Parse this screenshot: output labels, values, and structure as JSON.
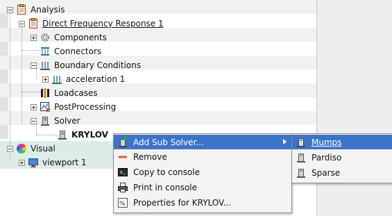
{
  "tree": {
    "analysis": "Analysis",
    "dfr": "Direct Frequency Response 1",
    "components": "Components",
    "connectors": "Connectors",
    "boundary_conditions": "Boundary Conditions",
    "acceleration": "acceleration 1",
    "loadcases": "Loadcases",
    "postprocessing": "PostProcessing",
    "solver": "Solver",
    "krylov": "KRYLOV",
    "visual": "Visual",
    "viewport": "viewport 1"
  },
  "context_menu": {
    "items": [
      {
        "label": "Add Sub Solver...",
        "mnemonic": ""
      },
      {
        "label": "Remove"
      },
      {
        "label": "Copy to console"
      },
      {
        "label": "Print in console"
      },
      {
        "label": "Properties for KRYLOV..."
      }
    ]
  },
  "submenu": {
    "items": [
      {
        "label": "Mumps"
      },
      {
        "label": "Pardiso"
      },
      {
        "label": "Sparse"
      }
    ]
  },
  "colors": {
    "highlight": "#3d74c7",
    "visual_row": "#dcede6"
  }
}
